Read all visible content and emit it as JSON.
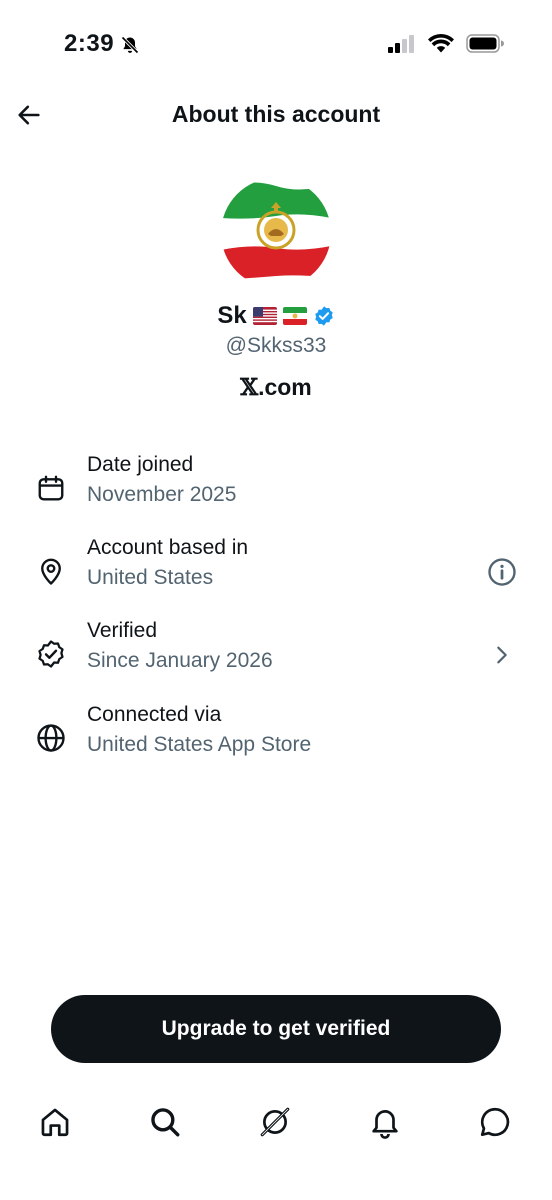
{
  "status_bar": {
    "time": "2:39",
    "icons": [
      "bell-slash-icon",
      "cellular-signal-icon",
      "wifi-icon",
      "battery-icon"
    ]
  },
  "header": {
    "title": "About this account",
    "back_icon": "arrow-left-icon"
  },
  "profile": {
    "avatar": "iran-lion-and-sun-flag",
    "name": "Sk",
    "name_flags": [
      "us-flag",
      "iran-lion-sun-flag"
    ],
    "verified_badge": "verified-check-icon",
    "handle": "@Skkss33",
    "domain_x": "𝕏",
    "domain_rest": ".com"
  },
  "info": {
    "date_joined": {
      "title": "Date joined",
      "value": "November 2025",
      "icon": "calendar-icon"
    },
    "account_based": {
      "title": "Account based in",
      "value": "United States",
      "icon": "location-pin-icon",
      "trailing_icon": "info-icon"
    },
    "verified": {
      "title": "Verified",
      "value": "Since January 2026",
      "icon": "verified-outline-icon",
      "trailing_icon": "chevron-right-icon"
    },
    "connected": {
      "title": "Connected via",
      "value": "United States App Store",
      "icon": "globe-icon"
    }
  },
  "upgrade_button": {
    "label": "Upgrade to get verified"
  },
  "bottom_nav": {
    "items": [
      "home-icon",
      "search-icon",
      "grok-icon",
      "notifications-icon",
      "messages-icon"
    ]
  },
  "colors": {
    "text_primary": "#0f1419",
    "text_secondary": "#536471",
    "verified_blue": "#1d9bf0",
    "button_bg": "#0f1419"
  }
}
